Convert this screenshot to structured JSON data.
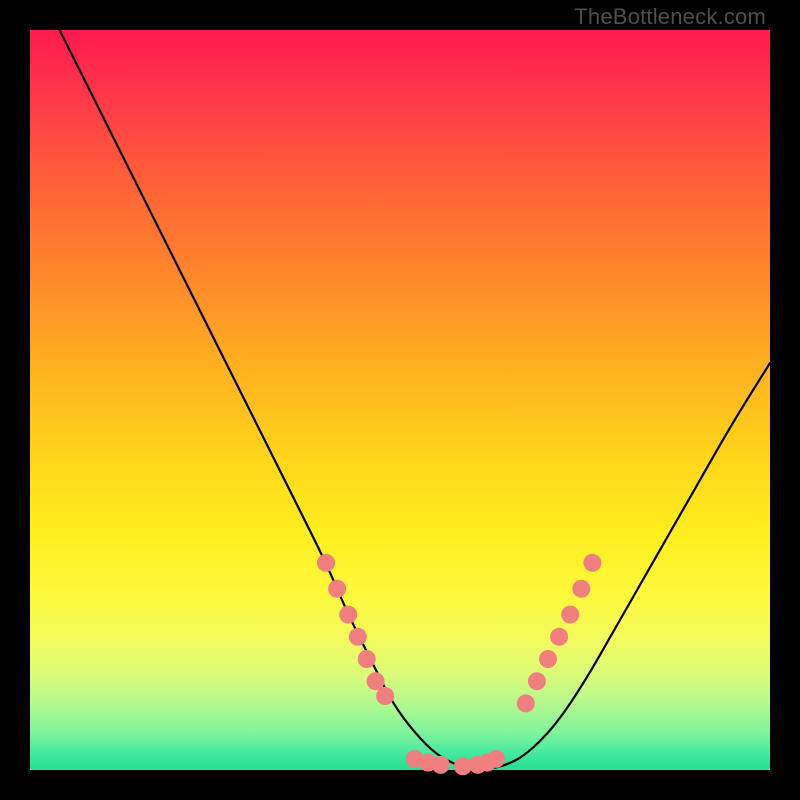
{
  "watermark": "TheBottleneck.com",
  "colors": {
    "background": "#000000",
    "dot": "#f17f7f",
    "curve": "#000000",
    "gradient_top": "#ff1a50",
    "gradient_mid": "#ffd61a",
    "gradient_bottom": "#22e08f"
  },
  "chart_data": {
    "type": "line",
    "title": "",
    "xlabel": "",
    "ylabel": "",
    "xlim": [
      0,
      100
    ],
    "ylim": [
      0,
      100
    ],
    "grid": false,
    "series": [
      {
        "name": "curve",
        "x": [
          4,
          8,
          12,
          16,
          20,
          24,
          28,
          32,
          36,
          40,
          43,
          46,
          49,
          52,
          55,
          58,
          61,
          64,
          67,
          71,
          75,
          79,
          83,
          87,
          91,
          95,
          100
        ],
        "y": [
          100,
          92,
          84,
          76,
          68,
          60,
          52,
          44,
          36,
          28,
          21,
          15,
          9,
          5,
          2,
          0.5,
          0,
          0.5,
          2,
          6,
          12,
          19,
          26,
          33,
          40,
          47,
          55
        ]
      }
    ],
    "markers": [
      {
        "name": "left-arm-dots",
        "x": [
          40.0,
          41.5,
          43.0,
          44.3,
          45.5,
          46.7,
          48.0
        ],
        "y": [
          28.0,
          24.5,
          21.0,
          18.0,
          15.0,
          12.0,
          10.0
        ]
      },
      {
        "name": "valley-dots",
        "x": [
          52.0,
          53.8,
          55.5,
          58.5,
          60.5,
          61.8,
          63.0
        ],
        "y": [
          1.5,
          1.0,
          0.7,
          0.5,
          0.7,
          1.0,
          1.5
        ]
      },
      {
        "name": "right-arm-dots",
        "x": [
          67.0,
          68.5,
          70.0,
          71.5,
          73.0,
          74.5,
          76.0
        ],
        "y": [
          9.0,
          12.0,
          15.0,
          18.0,
          21.0,
          24.5,
          28.0
        ]
      }
    ]
  }
}
